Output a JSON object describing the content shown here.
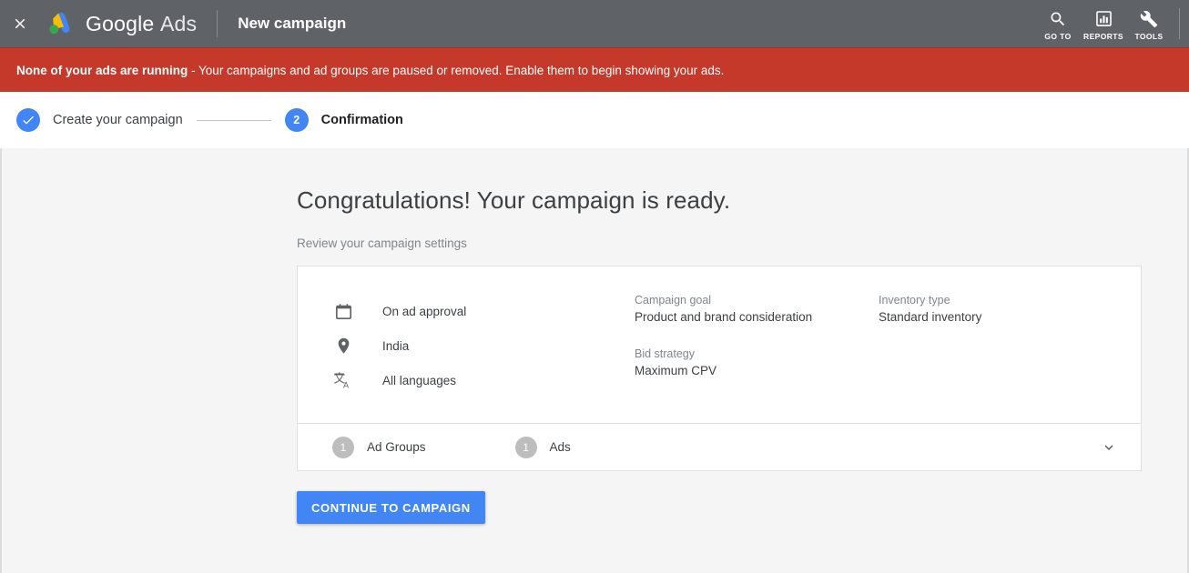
{
  "topbar": {
    "close_icon": "close-icon",
    "brand_google": "Google",
    "brand_ads": "Ads",
    "page_title": "New campaign",
    "actions": [
      {
        "icon": "search-icon",
        "label": "GO TO"
      },
      {
        "icon": "bar-chart-icon",
        "label": "REPORTS"
      },
      {
        "icon": "wrench-icon",
        "label": "TOOLS"
      }
    ]
  },
  "alert": {
    "strong": "None of your ads are running",
    "message": " - Your campaigns and ad groups are paused or removed. Enable them to begin showing your ads.",
    "background_color": "#c5392a"
  },
  "stepper": {
    "steps": [
      {
        "marker": "✓",
        "label": "Create your campaign",
        "state": "complete"
      },
      {
        "marker": "2",
        "label": "Confirmation",
        "state": "current"
      }
    ],
    "accent_color": "#4285f4"
  },
  "main": {
    "headline": "Congratulations! Your campaign is ready.",
    "subhead": "Review your campaign settings",
    "card": {
      "icon_rows": [
        {
          "icon": "calendar-icon",
          "text": "On ad approval"
        },
        {
          "icon": "location-pin-icon",
          "text": "India"
        },
        {
          "icon": "translate-icon",
          "text": "All languages"
        }
      ],
      "fields_column_1": [
        {
          "label": "Campaign goal",
          "value": "Product and brand consideration"
        },
        {
          "label": "Bid strategy",
          "value": "Maximum CPV"
        }
      ],
      "fields_column_2": [
        {
          "label": "Inventory type",
          "value": "Standard inventory"
        }
      ],
      "counts": [
        {
          "count": "1",
          "label": "Ad Groups"
        },
        {
          "count": "1",
          "label": "Ads"
        }
      ],
      "expand_icon": "chevron-down-icon"
    },
    "cta_label": "CONTINUE TO CAMPAIGN",
    "cta_color": "#4285f4"
  }
}
